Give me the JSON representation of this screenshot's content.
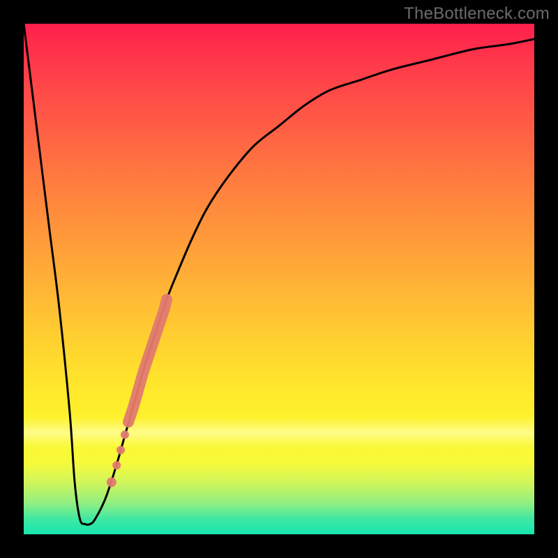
{
  "watermark": "TheBottleneck.com",
  "colors": {
    "curve": "#000000",
    "highlight": "#e37a6f",
    "frame": "#000000"
  },
  "chart_data": {
    "type": "line",
    "title": "",
    "xlabel": "",
    "ylabel": "",
    "xlim": [
      0,
      100
    ],
    "ylim": [
      0,
      100
    ],
    "series": [
      {
        "name": "bottleneck-curve",
        "x": [
          0,
          3,
          5,
          7,
          9,
          10,
          11,
          12,
          13,
          14,
          16,
          18,
          20,
          22,
          24,
          26,
          28,
          30,
          33,
          36,
          40,
          45,
          50,
          55,
          60,
          66,
          72,
          80,
          88,
          95,
          100
        ],
        "y": [
          100,
          76,
          60,
          44,
          24,
          10,
          3,
          2,
          2,
          3,
          7,
          13,
          20,
          27,
          34,
          40,
          46,
          51,
          58,
          64,
          70,
          76,
          80,
          84,
          87,
          89,
          91,
          93,
          95,
          96,
          97
        ]
      }
    ],
    "highlight_segment": {
      "name": "highlight-thick",
      "x": [
        20.5,
        21.5,
        22.5,
        23.5,
        24.5,
        25.5,
        26.5,
        27.5,
        28.0
      ],
      "y": [
        22,
        25,
        28.5,
        32,
        35,
        38,
        41,
        44,
        46
      ]
    },
    "highlight_dots": [
      {
        "x": 18.2,
        "y": 13.5,
        "r": 6
      },
      {
        "x": 19.0,
        "y": 16.5,
        "r": 6
      },
      {
        "x": 19.8,
        "y": 19.5,
        "r": 6
      },
      {
        "x": 17.2,
        "y": 10.2,
        "r": 7
      }
    ]
  }
}
